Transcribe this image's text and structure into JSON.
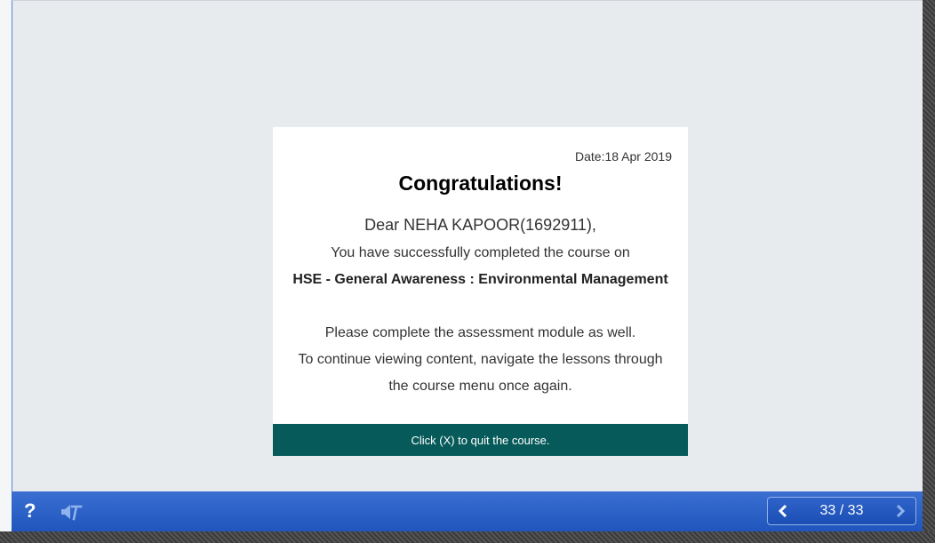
{
  "certificate": {
    "date": "Date:18 Apr 2019",
    "title": "Congratulations!",
    "greeting": "Dear NEHA KAPOOR(1692911),",
    "completed_text": "You have successfully completed the course on",
    "course_name": "HSE - General Awareness : Environmental Management",
    "assessment_text": "Please complete the assessment module as well.",
    "continue_text": "To continue viewing content, navigate the lessons through",
    "menu_text": "the course menu once again.",
    "footer_text": "Click (X) to quit the course."
  },
  "toolbar": {
    "help_label": "?",
    "page_indicator": "33 / 33"
  },
  "colors": {
    "stage_bg": "#e8ebee",
    "footer_bar": "#075a5a",
    "toolbar_blue": "#1f55bd"
  },
  "icons": {
    "help": "question-mark-icon",
    "audio": "audio-text-toggle-icon",
    "prev": "chevron-left-icon",
    "next": "chevron-right-icon"
  }
}
